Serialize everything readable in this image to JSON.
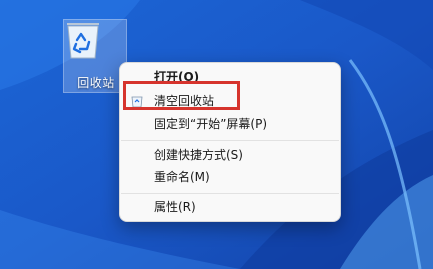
{
  "desktop": {
    "icon_label": "回收站"
  },
  "context_menu": {
    "items": [
      {
        "label": "打开(O)",
        "bold": true
      },
      {
        "label": "清空回收站",
        "icon": "recycle-bin-icon"
      },
      {
        "label": "固定到“开始”屏幕(P)"
      },
      {
        "label": "创建快捷方式(S)"
      },
      {
        "label": "重命名(M)"
      },
      {
        "label": "属性(R)"
      }
    ]
  },
  "colors": {
    "highlight_border": "#d6342d",
    "wallpaper_base": "#1d5fd3"
  }
}
